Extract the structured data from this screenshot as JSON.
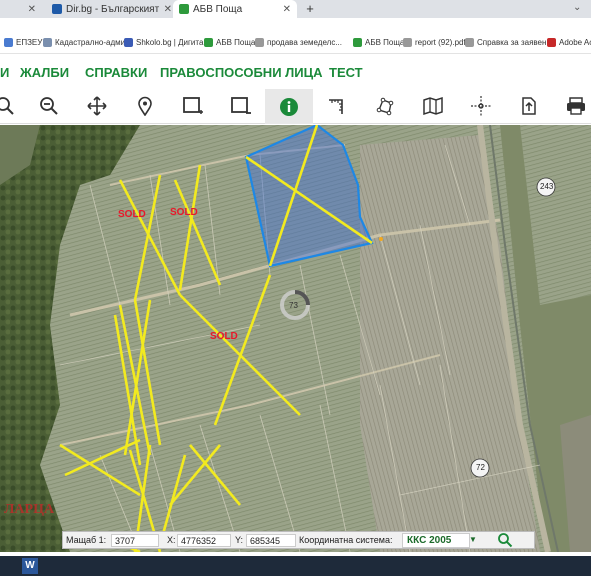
{
  "browser": {
    "tabs": [
      {
        "label": "Dir.bg - Българският Интернет",
        "active": false
      },
      {
        "label": "АБВ Поща",
        "active": true
      }
    ],
    "bookmarks": [
      "ЕПЗЕУ",
      "Кадастрално-адми...",
      "Shkolo.bg | Дигита...",
      "АБВ Поща",
      "продава земеделс...",
      "АБВ Поща",
      "report (92).pdf",
      "Справка за заявен...",
      "Adobe Acro"
    ]
  },
  "menu": {
    "items": [
      "И",
      "ЖАЛБИ",
      "СПРАВКИ",
      "ПРАВОСПОСОБНИ ЛИЦА",
      "ТЕСТ"
    ]
  },
  "toolbar": {
    "tools": [
      "zoom-in-icon",
      "zoom-out-icon",
      "pan-icon",
      "location-pin-icon",
      "select-rectangle-icon",
      "deselect-icon",
      "info-icon",
      "measure-icon",
      "polygon-icon",
      "map-icon",
      "crosshair-icon",
      "export-icon",
      "print-icon"
    ],
    "active_tool": "info-icon"
  },
  "map": {
    "sold_labels": [
      "SOLD",
      "SOLD",
      "SOLD"
    ],
    "road_labels": [
      "243",
      "72"
    ],
    "place_label": "ЛАРЦА",
    "loading_value": "73"
  },
  "statusbar": {
    "scale_label": "Мащаб 1:",
    "scale_value": "3707",
    "x_label": "X:",
    "x_value": "4776352",
    "y_label": "Y:",
    "y_value": "685345",
    "coord_label": "Координатна система:",
    "coord_value": "ККС 2005"
  },
  "colors": {
    "menu_green": "#1b8a3a",
    "parcel_blue": "#1e88e5",
    "line_yellow": "#f2ea1f",
    "sold_red": "#e8182a"
  }
}
